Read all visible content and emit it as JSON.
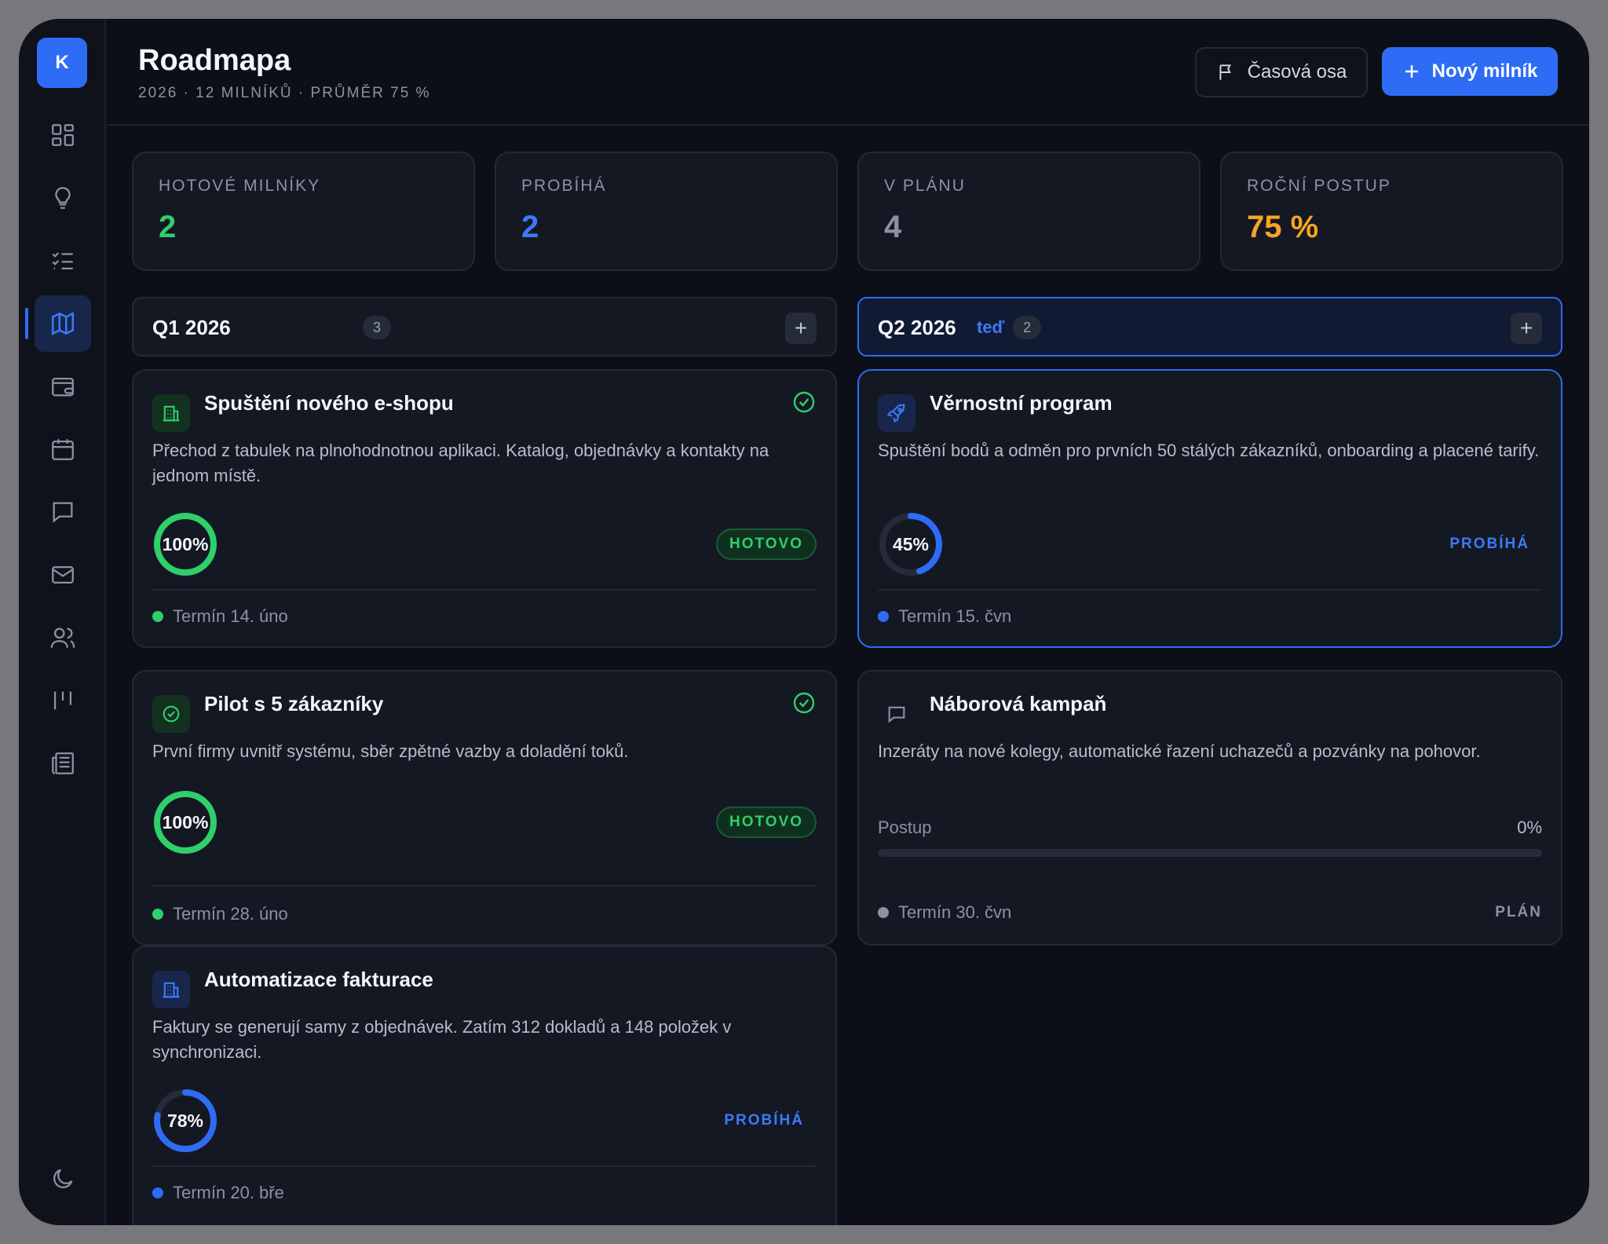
{
  "app": {
    "logo_letter": "K"
  },
  "header": {
    "title": "Roadmapa",
    "subtitle": "2026 · 12 MILNÍKŮ · PRŮMĚR 75 %",
    "timeline_button": "Časová osa",
    "new_button": "Nový milník"
  },
  "stats": [
    {
      "label": "HOTOVÉ MILNÍKY",
      "value": "2",
      "color": "#2fcf69"
    },
    {
      "label": "PROBÍHÁ",
      "value": "2",
      "color": "#3b7bf7"
    },
    {
      "label": "V PLÁNU",
      "value": "4",
      "color": "#8a92a6"
    },
    {
      "label": "ROČNÍ POSTUP",
      "value": "75 %",
      "color": "#f5a623"
    }
  ],
  "quarters": [
    {
      "title": "Q1 2026",
      "now_label": "",
      "count": "3"
    },
    {
      "title": "Q2 2026",
      "now_label": "teď",
      "count": "2"
    }
  ],
  "milestones": [
    {
      "title": "Spuštění nového e-shopu",
      "description": "Přechod z tabulek na plnohodnotnou aplikaci. Katalog, objednávky a kontakty na jednom místě.",
      "progress": 100,
      "progress_label": "100%",
      "status": "HOTOVO",
      "due": "Termín 14. úno",
      "icon": "building-icon"
    },
    {
      "title": "Pilot s 5 zákazníky",
      "description": "První firmy uvnitř systému, sběr zpětné vazby a doladění toků.",
      "progress": 100,
      "progress_label": "100%",
      "status": "HOTOVO",
      "due": "Termín 28. úno",
      "icon": "check-circle-icon"
    },
    {
      "title": "Automatizace fakturace",
      "description": "Faktury se generují samy z objednávek. Zatím 312 dokladů a 148 položek v synchronizaci.",
      "progress": 78,
      "progress_label": "78%",
      "status": "PROBÍHÁ",
      "due": "Termín 20. bře",
      "icon": "building-icon"
    },
    {
      "title": "Věrnostní program",
      "description": "Spuštění bodů a odměn pro prvních 50 stálých zákazníků, onboarding a placené tarify.",
      "progress": 45,
      "progress_label": "45%",
      "status": "PROBÍHÁ",
      "due": "Termín 15. čvn",
      "icon": "rocket-icon"
    },
    {
      "title": "Náborová kampaň",
      "description": "Inzeráty na nové kolegy, automatické řazení uchazečů a pozvánky na pohovor.",
      "progress": 0,
      "progress_label": "0%",
      "progress_caption": "Postup",
      "status": "PLÁN",
      "due": "Termín 30. čvn",
      "icon": "chat-icon"
    }
  ],
  "colors": {
    "accent": "#2e6cf6",
    "done": "#2fcf69",
    "progress": "#3b7bf7",
    "plan": "#8a92a6",
    "yearly": "#f5a623"
  }
}
